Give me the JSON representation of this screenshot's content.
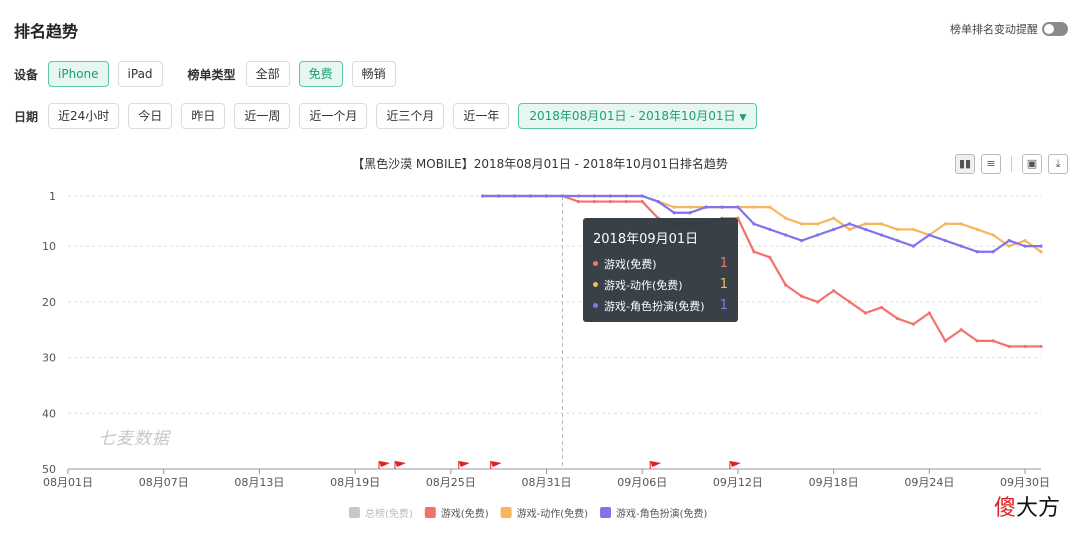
{
  "header": {
    "title": "排名趋势",
    "alert_label": "榜单排名变动提醒"
  },
  "filters": {
    "device_label": "设备",
    "devices": [
      "iPhone",
      "iPad"
    ],
    "device_selected": "iPhone",
    "list_type_label": "榜单类型",
    "list_types": [
      "全部",
      "免费",
      "畅销"
    ],
    "list_type_selected": "免费",
    "date_label": "日期",
    "dates": [
      "近24小时",
      "今日",
      "昨日",
      "近一周",
      "近一个月",
      "近三个月",
      "近一年"
    ],
    "date_range": "2018年08月01日 - 2018年10月01日"
  },
  "tooltip": {
    "date": "2018年09月01日",
    "items": [
      {
        "name": "游戏(免费)",
        "value": "1",
        "color": "#f2726a"
      },
      {
        "name": "游戏-动作(免费)",
        "value": "1",
        "color": "#f5b65c"
      },
      {
        "name": "游戏-角色扮演(免费)",
        "value": "1",
        "color": "#8172ee"
      }
    ]
  },
  "watermark": "七麦数据",
  "brand": {
    "red_part": "傻",
    "black_part": "大方"
  },
  "chart_data": {
    "type": "line",
    "title": "【黑色沙漠 MOBILE】2018年08月01日 - 2018年10月01日排名趋势",
    "xlabel": "",
    "ylabel": "",
    "y_inverted": true,
    "ylim": [
      50,
      1
    ],
    "yticks": [
      1,
      10,
      20,
      30,
      40,
      50
    ],
    "x_tick_labels": [
      "08月01日",
      "08月07日",
      "08月13日",
      "08月19日",
      "08月25日",
      "08月31日",
      "09月06日",
      "09月12日",
      "09月18日",
      "09月24日",
      "09月30日"
    ],
    "x_tick_days": [
      0,
      6,
      12,
      18,
      24,
      30,
      36,
      42,
      48,
      54,
      60
    ],
    "x_range_days": [
      0,
      61
    ],
    "x_unit": "days from 08月01日",
    "highlight_day": 31,
    "flag_days": [
      19.5,
      20.5,
      24.5,
      26.5,
      36.5,
      41.5
    ],
    "grid": true,
    "legend_position": "bottom",
    "series": [
      {
        "name": "总榜(免费)",
        "color": "#c8c8c8",
        "disabled": true,
        "x": [],
        "y": []
      },
      {
        "name": "游戏(免费)",
        "color": "#f2726a",
        "x": [
          26,
          27,
          28,
          29,
          30,
          31,
          32,
          33,
          34,
          35,
          36,
          37,
          38,
          39,
          40,
          41,
          42,
          43,
          44,
          45,
          46,
          47,
          48,
          49,
          50,
          51,
          52,
          53,
          54,
          55,
          56,
          57,
          58,
          59,
          60,
          61
        ],
        "y": [
          1,
          1,
          1,
          1,
          1,
          1,
          2,
          2,
          2,
          2,
          2,
          5,
          6,
          6,
          6,
          5,
          5,
          11,
          12,
          17,
          19,
          20,
          18,
          20,
          22,
          21,
          23,
          24,
          22,
          27,
          25,
          27,
          27,
          28,
          28,
          28
        ]
      },
      {
        "name": "游戏-动作(免费)",
        "color": "#f5b65c",
        "x": [
          26,
          27,
          28,
          29,
          30,
          31,
          32,
          33,
          34,
          35,
          36,
          37,
          38,
          39,
          40,
          41,
          42,
          43,
          44,
          45,
          46,
          47,
          48,
          49,
          50,
          51,
          52,
          53,
          54,
          55,
          56,
          57,
          58,
          59,
          60,
          61
        ],
        "y": [
          1,
          1,
          1,
          1,
          1,
          1,
          1,
          1,
          1,
          1,
          1,
          2,
          3,
          3,
          3,
          3,
          3,
          3,
          3,
          5,
          6,
          6,
          5,
          7,
          6,
          6,
          7,
          7,
          8,
          6,
          6,
          7,
          8,
          10,
          9,
          11
        ]
      },
      {
        "name": "游戏-角色扮演(免费)",
        "color": "#8172ee",
        "x": [
          26,
          27,
          28,
          29,
          30,
          31,
          32,
          33,
          34,
          35,
          36,
          37,
          38,
          39,
          40,
          41,
          42,
          43,
          44,
          45,
          46,
          47,
          48,
          49,
          50,
          51,
          52,
          53,
          54,
          55,
          56,
          57,
          58,
          59,
          60,
          61
        ],
        "y": [
          1,
          1,
          1,
          1,
          1,
          1,
          1,
          1,
          1,
          1,
          1,
          2,
          4,
          4,
          3,
          3,
          3,
          6,
          7,
          8,
          9,
          8,
          7,
          6,
          7,
          8,
          9,
          10,
          8,
          9,
          10,
          11,
          11,
          9,
          10,
          10
        ]
      }
    ]
  }
}
